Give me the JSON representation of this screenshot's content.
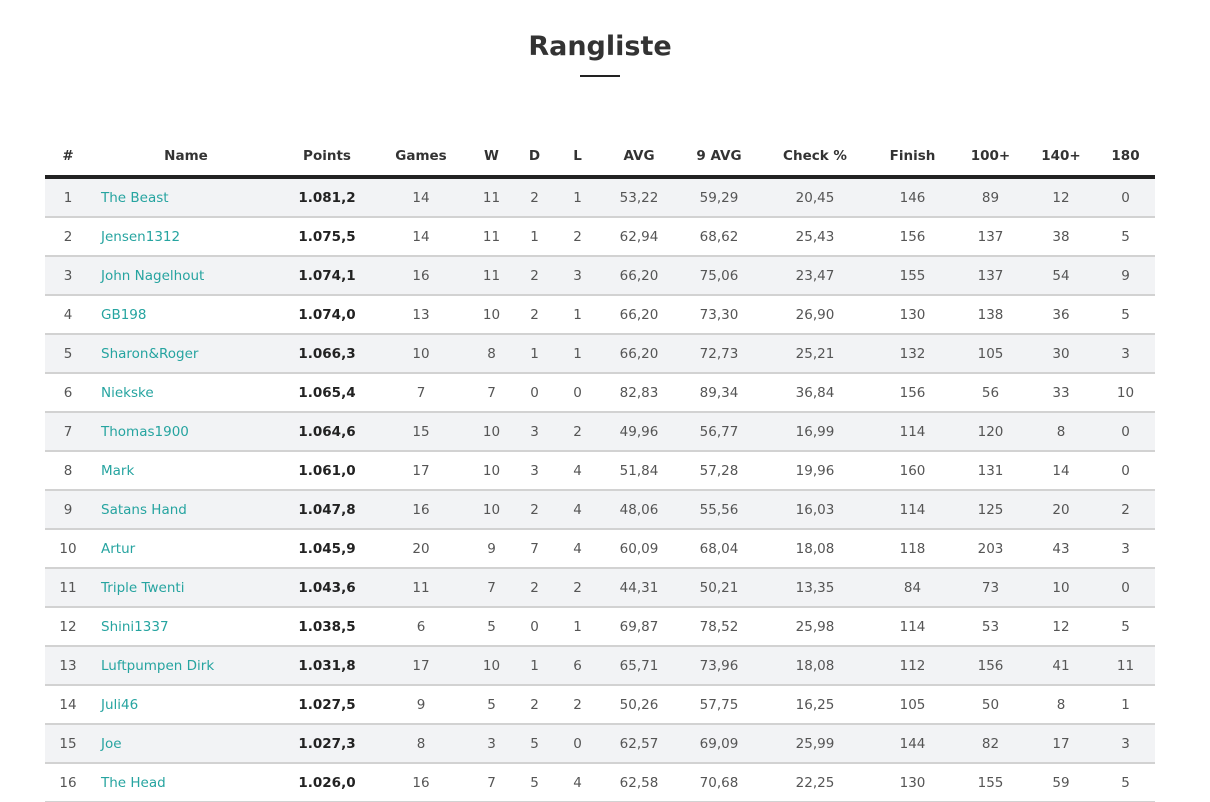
{
  "page": {
    "title": "Rangliste"
  },
  "table": {
    "headers": [
      "#",
      "Name",
      "Points",
      "Games",
      "W",
      "D",
      "L",
      "AVG",
      "9 AVG",
      "Check %",
      "Finish",
      "100+",
      "140+",
      "180"
    ],
    "rows": [
      [
        "1",
        "The Beast",
        "1.081,2",
        "14",
        "11",
        "2",
        "1",
        "53,22",
        "59,29",
        "20,45",
        "146",
        "89",
        "12",
        "0"
      ],
      [
        "2",
        "Jensen1312",
        "1.075,5",
        "14",
        "11",
        "1",
        "2",
        "62,94",
        "68,62",
        "25,43",
        "156",
        "137",
        "38",
        "5"
      ],
      [
        "3",
        "John Nagelhout",
        "1.074,1",
        "16",
        "11",
        "2",
        "3",
        "66,20",
        "75,06",
        "23,47",
        "155",
        "137",
        "54",
        "9"
      ],
      [
        "4",
        "GB198",
        "1.074,0",
        "13",
        "10",
        "2",
        "1",
        "66,20",
        "73,30",
        "26,90",
        "130",
        "138",
        "36",
        "5"
      ],
      [
        "5",
        "Sharon&Roger",
        "1.066,3",
        "10",
        "8",
        "1",
        "1",
        "66,20",
        "72,73",
        "25,21",
        "132",
        "105",
        "30",
        "3"
      ],
      [
        "6",
        "Niekske",
        "1.065,4",
        "7",
        "7",
        "0",
        "0",
        "82,83",
        "89,34",
        "36,84",
        "156",
        "56",
        "33",
        "10"
      ],
      [
        "7",
        "Thomas1900",
        "1.064,6",
        "15",
        "10",
        "3",
        "2",
        "49,96",
        "56,77",
        "16,99",
        "114",
        "120",
        "8",
        "0"
      ],
      [
        "8",
        "Mark",
        "1.061,0",
        "17",
        "10",
        "3",
        "4",
        "51,84",
        "57,28",
        "19,96",
        "160",
        "131",
        "14",
        "0"
      ],
      [
        "9",
        "Satans Hand",
        "1.047,8",
        "16",
        "10",
        "2",
        "4",
        "48,06",
        "55,56",
        "16,03",
        "114",
        "125",
        "20",
        "2"
      ],
      [
        "10",
        "Artur",
        "1.045,9",
        "20",
        "9",
        "7",
        "4",
        "60,09",
        "68,04",
        "18,08",
        "118",
        "203",
        "43",
        "3"
      ],
      [
        "11",
        "Triple Twenti",
        "1.043,6",
        "11",
        "7",
        "2",
        "2",
        "44,31",
        "50,21",
        "13,35",
        "84",
        "73",
        "10",
        "0"
      ],
      [
        "12",
        "Shini1337",
        "1.038,5",
        "6",
        "5",
        "0",
        "1",
        "69,87",
        "78,52",
        "25,98",
        "114",
        "53",
        "12",
        "5"
      ],
      [
        "13",
        "Luftpumpen Dirk",
        "1.031,8",
        "17",
        "10",
        "1",
        "6",
        "65,71",
        "73,96",
        "18,08",
        "112",
        "156",
        "41",
        "11"
      ],
      [
        "14",
        "Juli46",
        "1.027,5",
        "9",
        "5",
        "2",
        "2",
        "50,26",
        "57,75",
        "16,25",
        "105",
        "50",
        "8",
        "1"
      ],
      [
        "15",
        "Joe",
        "1.027,3",
        "8",
        "3",
        "5",
        "0",
        "62,57",
        "69,09",
        "25,99",
        "144",
        "82",
        "17",
        "3"
      ],
      [
        "16",
        "The Head",
        "1.026,0",
        "16",
        "7",
        "5",
        "4",
        "62,58",
        "70,68",
        "22,25",
        "130",
        "155",
        "59",
        "5"
      ]
    ]
  },
  "colors": {
    "link": "#26a4a0",
    "stripe": "#f2f3f5",
    "header_rule": "#222222",
    "row_rule": "#d2d2d2"
  }
}
